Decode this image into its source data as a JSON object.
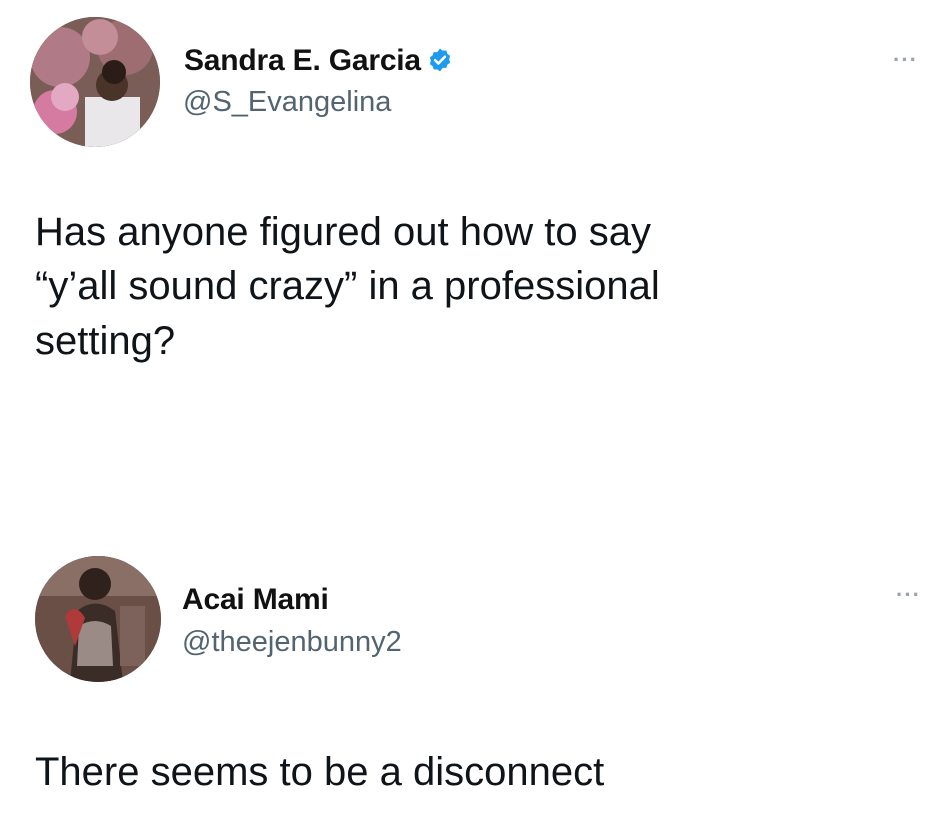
{
  "tweets": [
    {
      "display_name": "Sandra E. Garcia",
      "handle": "@S_Evangelina",
      "verified": true,
      "text": "Has anyone figured out how to say\n“y’all sound crazy” in a professional\nsetting?",
      "more_icon": "more-icon"
    },
    {
      "display_name": "Acai Mami",
      "handle": "@theejenbunny2",
      "verified": false,
      "text": "There seems to be a disconnect",
      "more_icon": "more-icon"
    }
  ],
  "colors": {
    "background": "#ffffff",
    "text": "#0f1419",
    "handle": "#536471",
    "verified_badge": "#1d9bf0"
  }
}
